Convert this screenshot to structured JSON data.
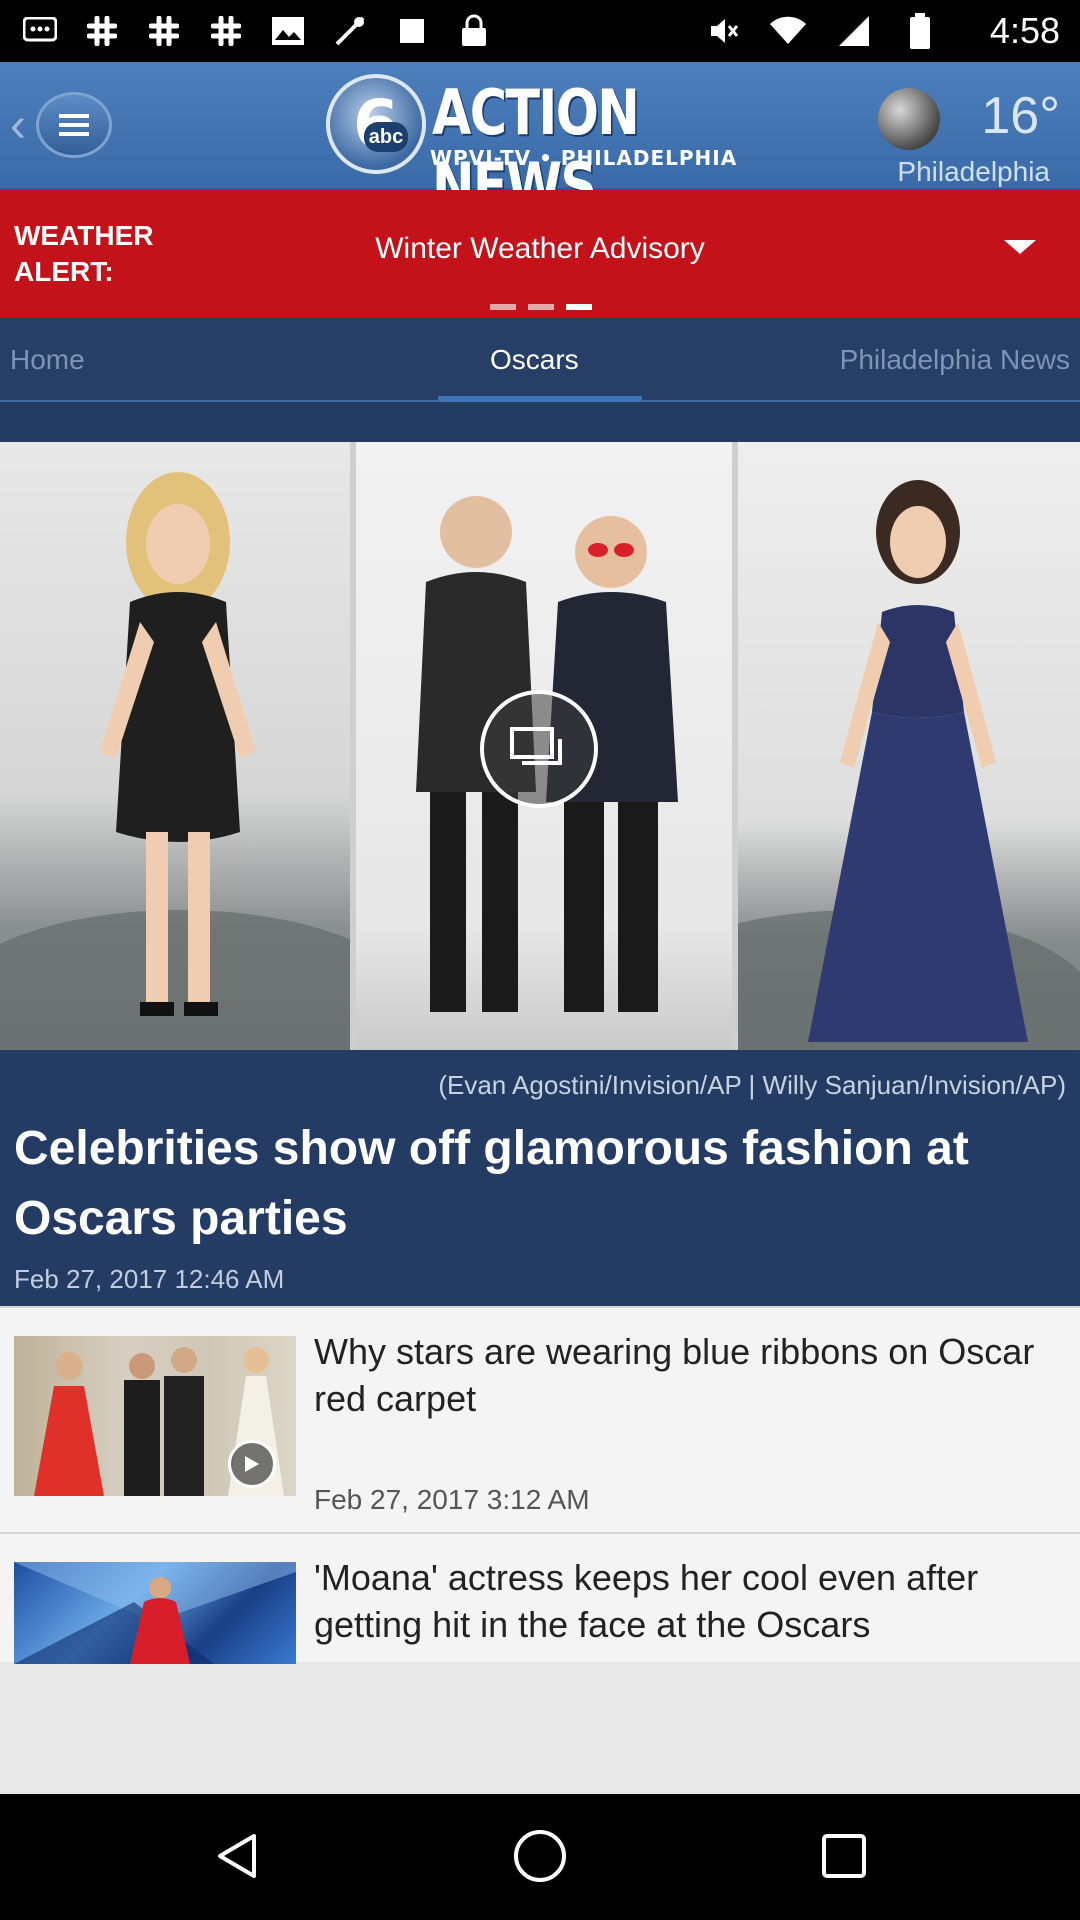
{
  "status_bar": {
    "time": "4:58",
    "left_icons": [
      "chat-icon",
      "slack-icon",
      "slack-icon",
      "slack-icon",
      "photo-icon",
      "signal-icon",
      "notification-icon",
      "lock-icon"
    ],
    "right_icons": [
      "mute-icon",
      "wifi-icon",
      "signal-icon",
      "battery-icon"
    ]
  },
  "header": {
    "logo_number": "6",
    "logo_network": "abc",
    "logo_title": "ACTION NEWS",
    "logo_subtitle": "WPVI-TV • PHILADELPHIA",
    "weather": {
      "temperature": "16°",
      "city": "Philadelphia",
      "icon": "moon-icon"
    }
  },
  "alert": {
    "label": "WEATHER ALERT:",
    "text": "Winter Weather Advisory",
    "pager": {
      "count": 3,
      "active_index": 2
    }
  },
  "tabs": [
    {
      "label": "Home",
      "active": false
    },
    {
      "label": "Oscars",
      "active": true
    },
    {
      "label": "Philadelphia News",
      "active": false
    }
  ],
  "hero": {
    "credit": "(Evan Agostini/Invision/AP | Willy Sanjuan/Invision/AP)",
    "headline": "Celebrities show off glamorous fashion at Oscars parties",
    "date": "Feb 27, 2017 12:46 AM",
    "media_icon": "gallery-icon"
  },
  "stories": [
    {
      "title": "Why stars are wearing blue ribbons on Oscar red carpet",
      "date": "Feb 27, 2017 3:12 AM",
      "media_icon": "play-icon"
    },
    {
      "title": "'Moana' actress keeps her cool even after getting hit in the face at the Oscars",
      "date": ""
    }
  ],
  "colors": {
    "header_blue": "#3a6aa8",
    "alert_red": "#c4121a",
    "tab_bar": "#273f66",
    "hero_bg": "#243b63"
  }
}
